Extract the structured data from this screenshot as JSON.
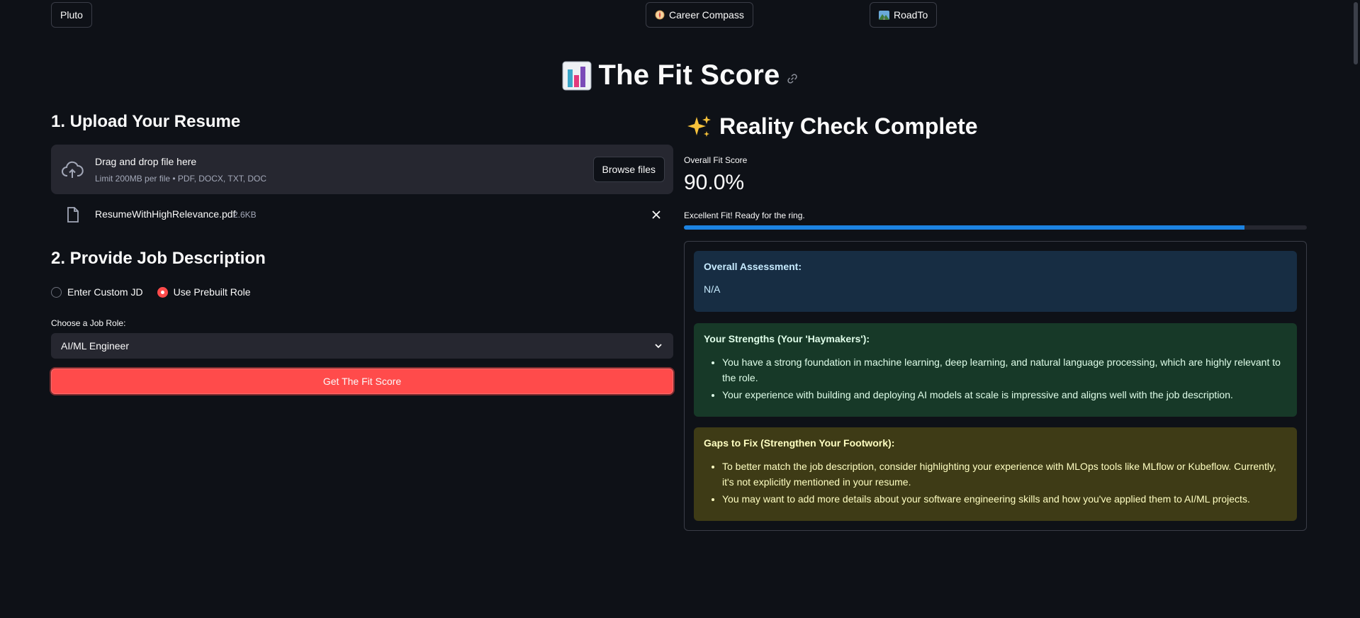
{
  "nav": {
    "pluto": "Pluto",
    "career_compass": "Career Compass",
    "roadto": "RoadTo"
  },
  "title": "The Fit Score",
  "upload": {
    "heading": "1. Upload Your Resume",
    "drag_text": "Drag and drop file here",
    "limit_text": "Limit 200MB per file • PDF, DOCX, TXT, DOC",
    "browse_label": "Browse files",
    "file_name": "ResumeWithHighRelevance.pdf",
    "file_size": "2.6KB"
  },
  "job": {
    "heading": "2. Provide Job Description",
    "radio_options": [
      "Enter Custom JD",
      "Use Prebuilt Role"
    ],
    "selected_option": "Use Prebuilt Role",
    "select_label": "Choose a Job Role:",
    "selected_role": "AI/ML Engineer",
    "submit_label": "Get The Fit Score"
  },
  "results": {
    "heading": "Reality Check Complete",
    "metric_label": "Overall Fit Score",
    "metric_value": "90.0%",
    "progress_text": "Excellent Fit! Ready for the ring.",
    "progress_fraction": 0.9,
    "assessment_title": "Overall Assessment:",
    "assessment_body": "N/A",
    "strengths_title": "Your Strengths (Your 'Haymakers'):",
    "strengths": [
      "You have a strong foundation in machine learning, deep learning, and natural language processing, which are highly relevant to the role.",
      "Your experience with building and deploying AI models at scale is impressive and aligns well with the job description."
    ],
    "gaps_title": "Gaps to Fix (Strengthen Your Footwork):",
    "gaps": [
      "To better match the job description, consider highlighting your experience with MLOps tools like MLflow or Kubeflow. Currently, it's not explicitly mentioned in your resume.",
      "You may want to add more details about your software engineering skills and how you've applied them to AI/ML projects."
    ]
  },
  "colors": {
    "background": "#0e1117",
    "primary": "#ff4b4b",
    "progress": "#1c83e1",
    "info_bg": "#172d43",
    "success_bg": "#173928",
    "warning_bg": "#3e3b16"
  }
}
